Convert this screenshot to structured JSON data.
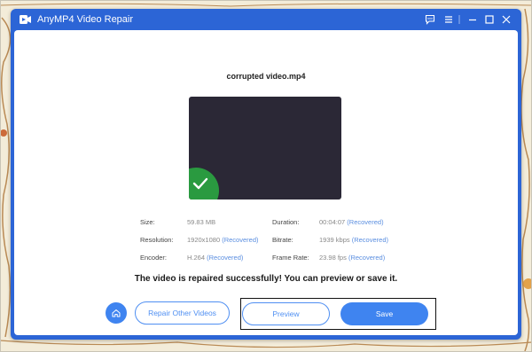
{
  "window": {
    "title": "AnyMP4 Video Repair"
  },
  "file": {
    "name": "corrupted video.mp4"
  },
  "info": {
    "size_label": "Size:",
    "size_value": "59.83 MB",
    "resolution_label": "Resolution:",
    "resolution_value": "1920x1080",
    "resolution_tag": "(Recovered)",
    "encoder_label": "Encoder:",
    "encoder_value": "H.264",
    "encoder_tag": "(Recovered)",
    "duration_label": "Duration:",
    "duration_value": "00:04:07",
    "duration_tag": "(Recovered)",
    "bitrate_label": "Bitrate:",
    "bitrate_value": "1939 kbps",
    "bitrate_tag": "(Recovered)",
    "framerate_label": "Frame Rate:",
    "framerate_value": "23.98 fps",
    "framerate_tag": "(Recovered)"
  },
  "status": {
    "message": "The video is repaired successfully! You can preview or save it."
  },
  "actions": {
    "repair_other_label": "Repair Other Videos",
    "preview_label": "Preview",
    "save_label": "Save"
  },
  "colors": {
    "accent": "#3f84f0",
    "titlebar": "#2c65d6",
    "success": "#2a9a40",
    "preview_bg": "#2b2836"
  },
  "icons": {
    "app": "anymp4-logo-icon",
    "feedback": "feedback-icon",
    "menu": "menu-icon",
    "minimize": "minimize-icon",
    "maximize": "maximize-icon",
    "close": "close-icon",
    "home": "home-icon",
    "check": "check-icon"
  }
}
